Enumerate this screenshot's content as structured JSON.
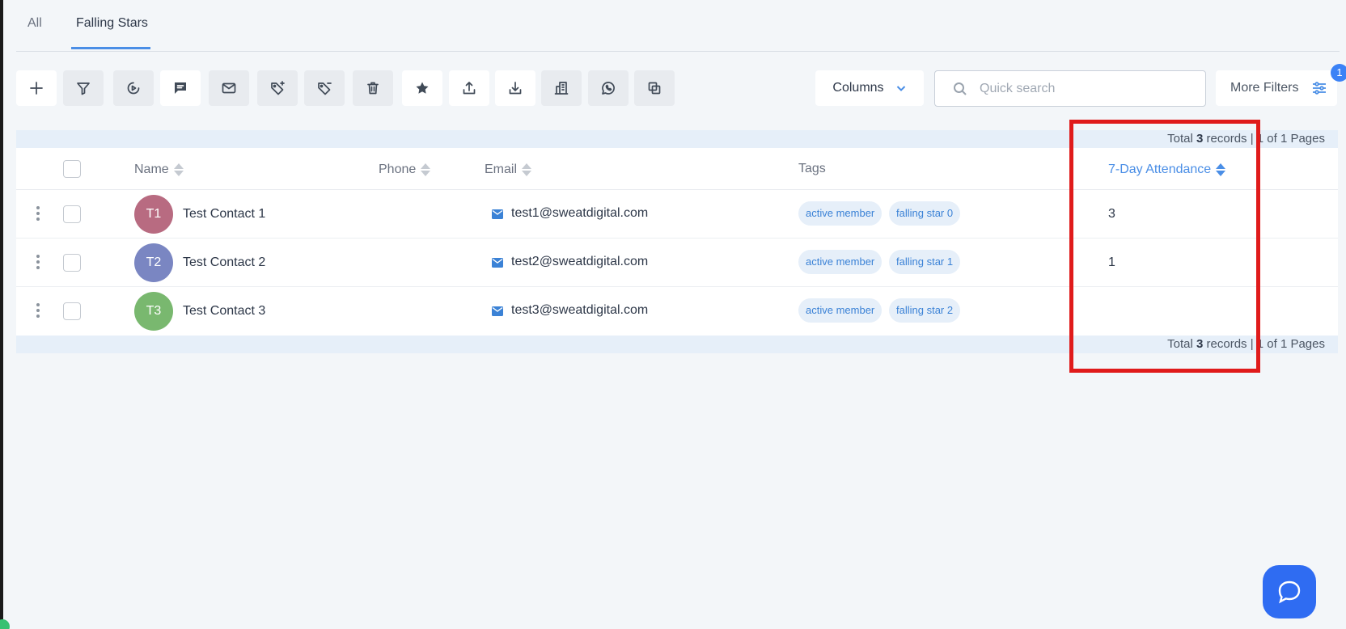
{
  "tabs": [
    {
      "label": "All"
    },
    {
      "label": "Falling Stars"
    }
  ],
  "toolbar": {
    "buttons": [
      {
        "icon": "plus-icon"
      },
      {
        "icon": "filter-icon"
      },
      {
        "icon": "play-circle-icon"
      },
      {
        "icon": "message-icon"
      },
      {
        "icon": "mail-icon"
      },
      {
        "icon": "tag-add-icon"
      },
      {
        "icon": "tag-remove-icon"
      },
      {
        "icon": "trash-icon"
      },
      {
        "icon": "star-icon"
      },
      {
        "icon": "upload-icon"
      },
      {
        "icon": "download-icon"
      },
      {
        "icon": "building-icon"
      },
      {
        "icon": "whatsapp-icon"
      },
      {
        "icon": "copy-icon"
      }
    ],
    "columns_label": "Columns",
    "search_placeholder": "Quick search",
    "more_filters_label": "More Filters",
    "filter_count": "1"
  },
  "summary": {
    "prefix": "Total",
    "count": "3",
    "suffix": "records | 1 of 1 Pages"
  },
  "table": {
    "headers": {
      "name": "Name",
      "phone": "Phone",
      "email": "Email",
      "tags": "Tags",
      "attendance": "7-Day Attendance"
    },
    "rows": [
      {
        "initials": "T1",
        "avatar_color": "#b86b81",
        "name": "Test Contact 1",
        "phone": "",
        "email": "test1@sweatdigital.com",
        "tags": [
          "active member",
          "falling star 0"
        ],
        "attendance": "3"
      },
      {
        "initials": "T2",
        "avatar_color": "#7a86c2",
        "name": "Test Contact 2",
        "phone": "",
        "email": "test2@sweatdigital.com",
        "tags": [
          "active member",
          "falling star 1"
        ],
        "attendance": "1"
      },
      {
        "initials": "T3",
        "avatar_color": "#79b86f",
        "name": "Test Contact 3",
        "phone": "",
        "email": "test3@sweatdigital.com",
        "tags": [
          "active member",
          "falling star 2"
        ],
        "attendance": ""
      }
    ]
  },
  "colors": {
    "accent": "#4a8ee6",
    "highlight": "#e01b1b",
    "chat_button": "#2f6cf2"
  }
}
